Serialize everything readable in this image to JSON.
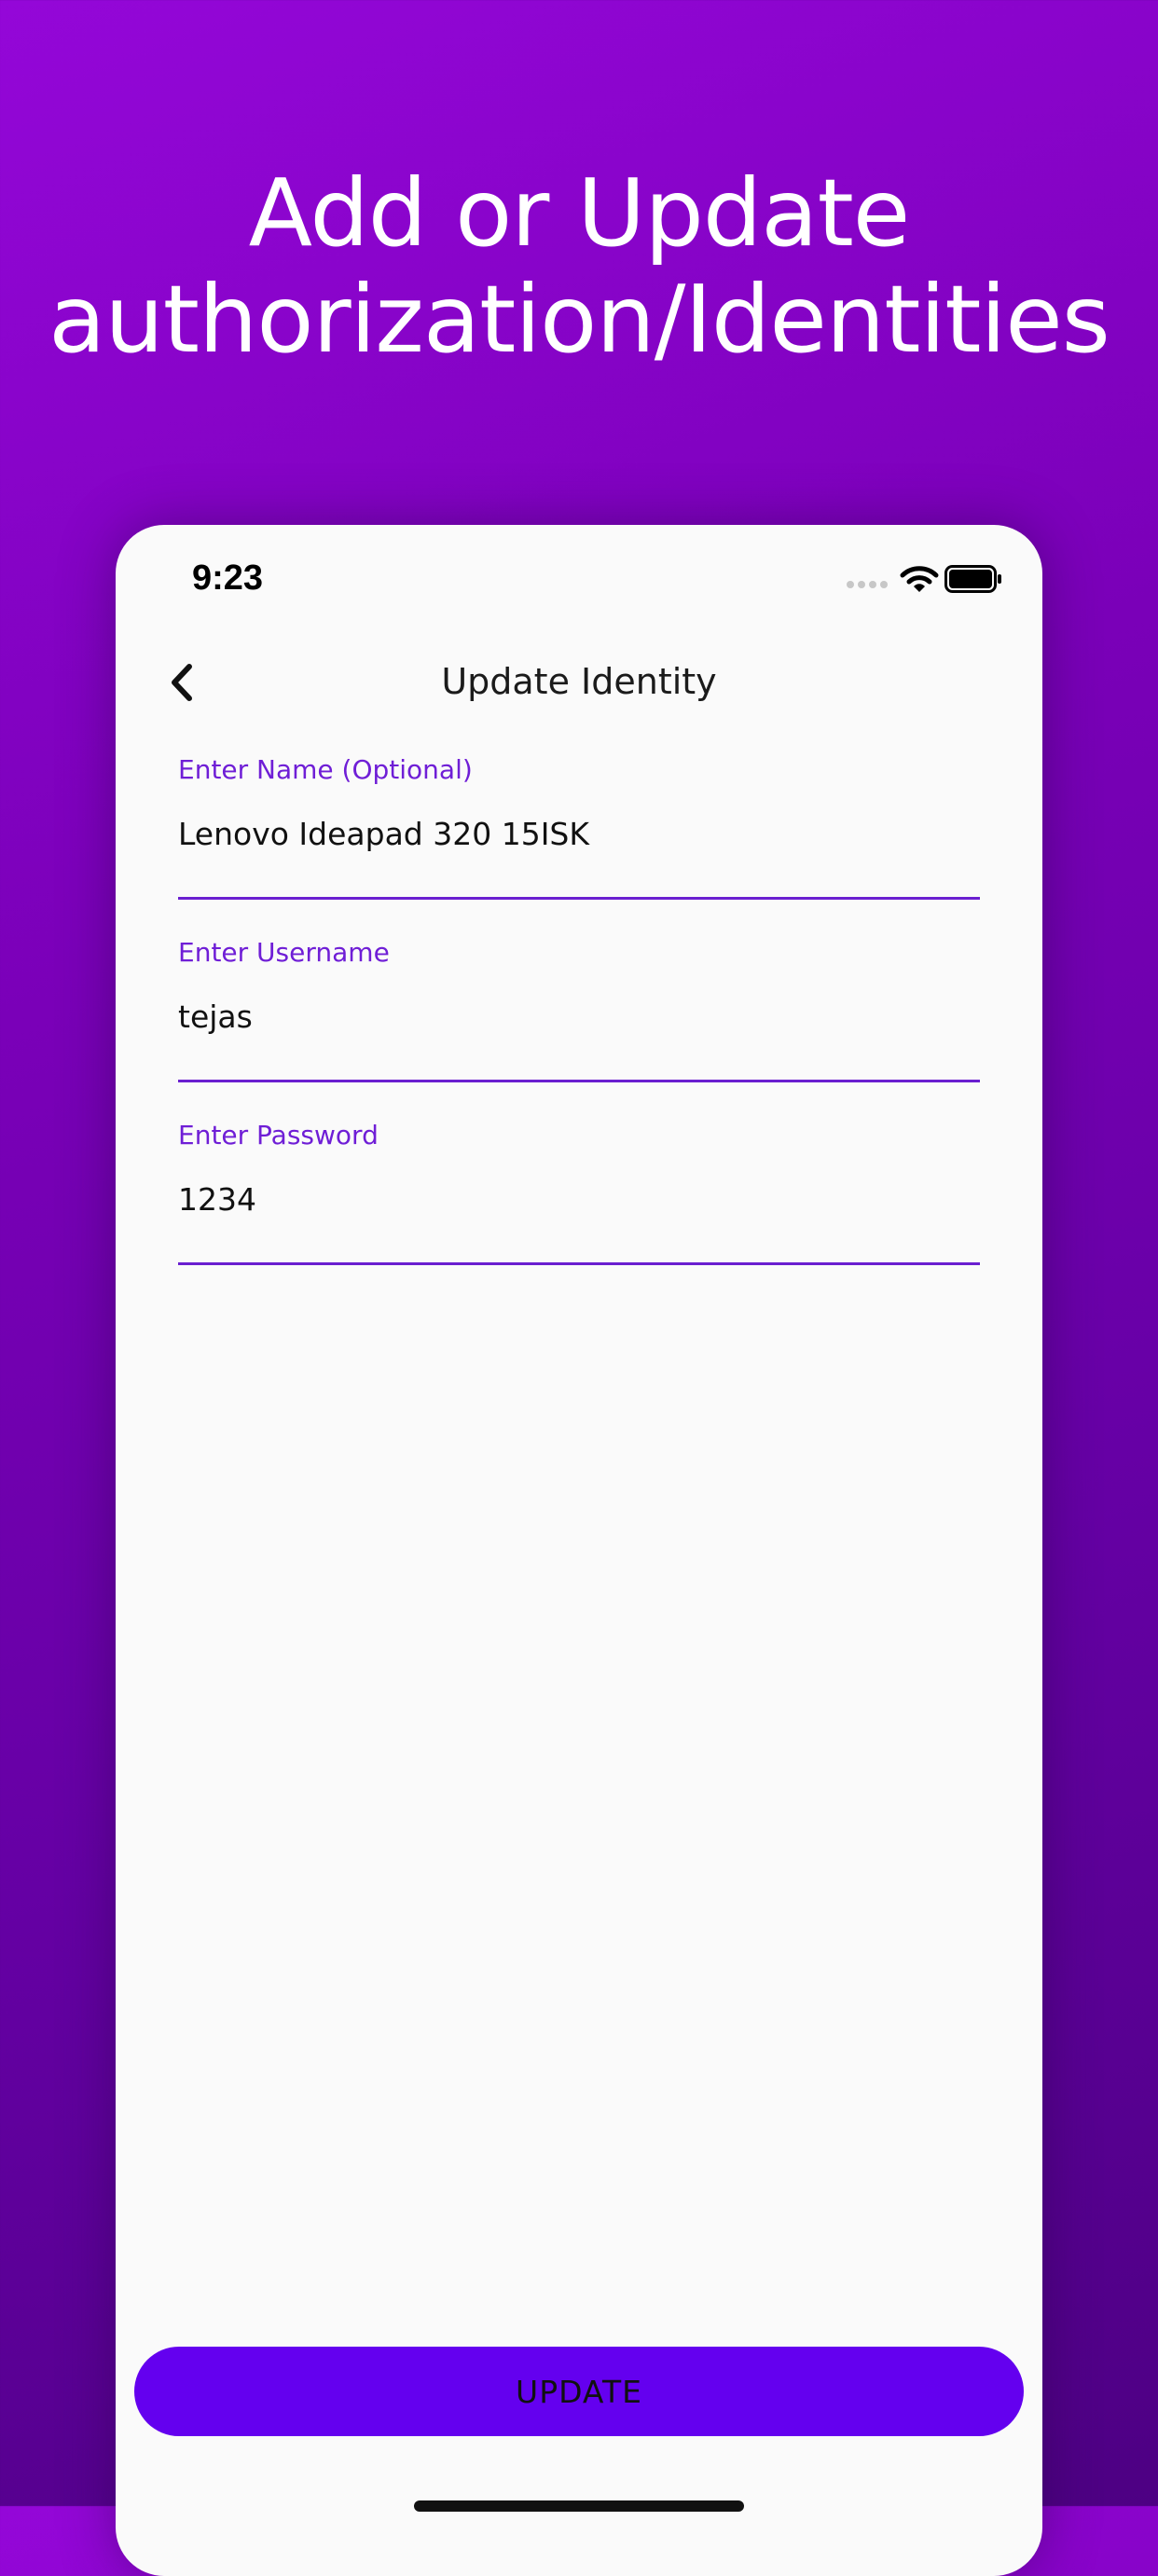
{
  "headline": {
    "line1": "Add or Update",
    "line2": "authorization/Identities"
  },
  "status_bar": {
    "time": "9:23",
    "icons": [
      "cellular-signal-icon",
      "wifi-icon",
      "battery-icon"
    ]
  },
  "nav": {
    "title": "Update Identity",
    "back_icon": "chevron-left-icon"
  },
  "form": {
    "name": {
      "label": "Enter Name (Optional)",
      "value": "Lenovo Ideapad 320 15ISK"
    },
    "username": {
      "label": "Enter Username",
      "value": "tejas"
    },
    "password": {
      "label": "Enter Password",
      "value": "1234"
    }
  },
  "actions": {
    "update_label": "UPDATE"
  },
  "colors": {
    "background_top": "#9407d8",
    "background_bottom": "#4d0083",
    "accent": "#6f1ed6",
    "button": "#6400ef"
  }
}
